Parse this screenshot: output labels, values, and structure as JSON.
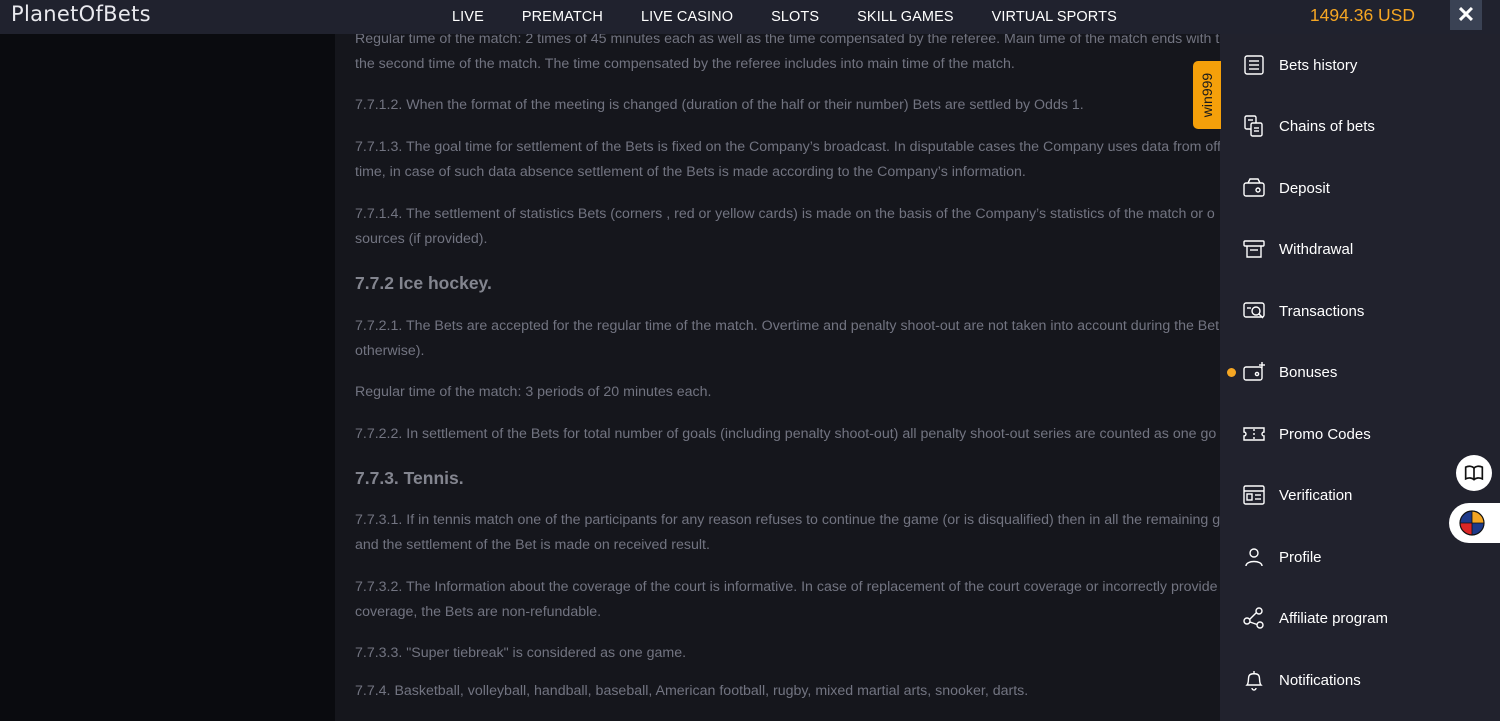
{
  "header": {
    "logo": "PlanetOfBets",
    "nav": [
      "LIVE",
      "PREMATCH",
      "LIVE CASINO",
      "SLOTS",
      "SKILL GAMES",
      "VIRTUAL SPORTS"
    ],
    "balance": "1494.36 USD",
    "close": "✕"
  },
  "promo_tab": "win999",
  "content": {
    "lines": [
      "Regular time of the match: 2 times of 45 minutes each as well as the time compensated by the referee. Main time of the match ends with the",
      "the second time of the match. The time compensated by the referee includes into main time of the match.",
      "7.7.1.2. When the format of the meeting is changed (duration of the half or their number) Bets are settled by Odds 1.",
      "7.7.1.3. The goal time for settlement of the Bets is fixed on the Company’s broadcast. In disputable cases the Company uses data from offi",
      "time, in case of such data absence settlement of the Bets is made according to the Company’s information.",
      "7.7.1.4. The settlement of statistics Bets (corners , red or yellow cards) is made on the basis of the Company’s statistics of the match or o",
      "sources (if provided).",
      "7.7.2.1. The Bets are accepted for the regular time of the match. Overtime and penalty shoot-out are not taken into account during the Bet s",
      "otherwise).",
      "Regular time of the match: 3 periods of 20 minutes each.",
      "7.7.2.2. In settlement of the Bets for total number of goals (including penalty shoot-out) all penalty shoot-out series are counted as one go",
      "7.7.3.1. If in tennis match one of the participants for any reason refuses to continue the game (or is disqualified) then in all the remaining g",
      "and the settlement of the Bet is made on received result.",
      "7.7.3.2. The Information about the coverage of the court is informative. In case of replacement of the court coverage or incorrectly provide",
      "coverage, the Bets are non-refundable.",
      "7.7.3.3. \"Super tiebreak\" is considered as one game.",
      "7.7.4. Basketball, volleyball, handball, baseball, American football, rugby, mixed martial arts, snooker, darts."
    ],
    "headings": [
      "7.7.2 Ice hockey.",
      "7.7.3. Tennis."
    ]
  },
  "menu": [
    {
      "label": "Bets history",
      "icon": "list-icon"
    },
    {
      "label": "Chains of bets",
      "icon": "chain-icon"
    },
    {
      "label": "Deposit",
      "icon": "wallet-in-icon"
    },
    {
      "label": "Withdrawal",
      "icon": "withdraw-icon"
    },
    {
      "label": "Transactions",
      "icon": "transactions-icon"
    },
    {
      "label": "Bonuses",
      "icon": "bonus-wallet-icon",
      "has_dot": true
    },
    {
      "label": "Promo Codes",
      "icon": "ticket-icon"
    },
    {
      "label": "Verification",
      "icon": "id-card-icon"
    },
    {
      "label": "Profile",
      "icon": "user-icon"
    },
    {
      "label": "Affiliate program",
      "icon": "share-icon"
    },
    {
      "label": "Notifications",
      "icon": "bell-icon"
    }
  ],
  "colors": {
    "accent": "#f5a623",
    "panel": "#21222d",
    "topbar": "#20222e",
    "content_bg": "#15161c"
  }
}
